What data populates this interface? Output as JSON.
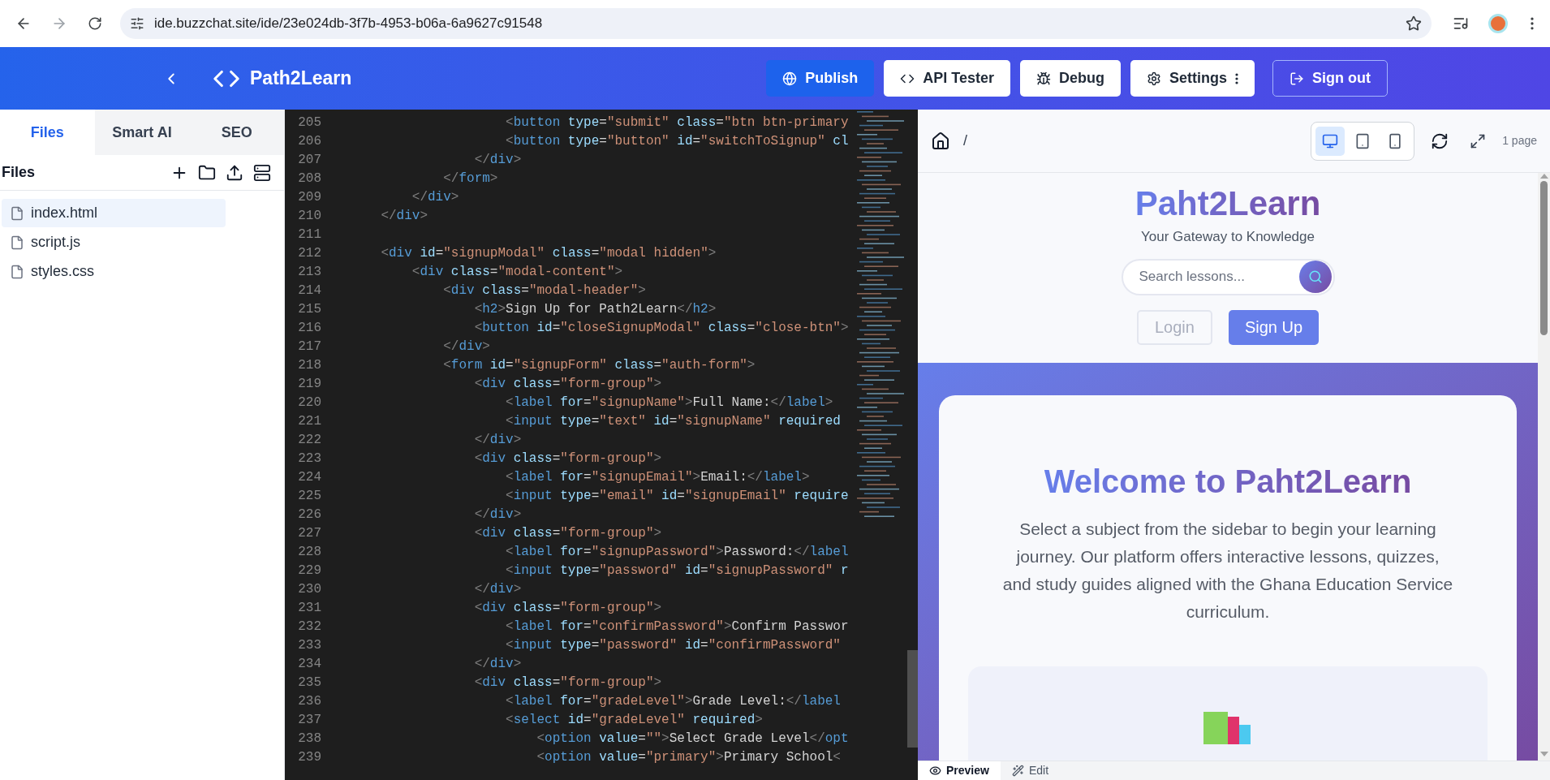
{
  "browser": {
    "url": "ide.buzzchat.site/ide/23e024db-3f7b-4953-b06a-6a9627c91548"
  },
  "header": {
    "title": "Path2Learn",
    "buttons": [
      {
        "label": "Publish",
        "kind": "publish"
      },
      {
        "label": "API Tester",
        "kind": "api"
      },
      {
        "label": "Debug",
        "kind": "debug"
      },
      {
        "label": "Settings",
        "kind": "settings"
      },
      {
        "label": "Sign out",
        "kind": "signout"
      }
    ]
  },
  "sidebar": {
    "tabs": [
      {
        "label": "Files",
        "selected": true
      },
      {
        "label": "Smart AI",
        "selected": false
      },
      {
        "label": "SEO",
        "selected": false
      }
    ],
    "heading": "Files",
    "files": [
      {
        "name": "index.html",
        "selected": true
      },
      {
        "name": "script.js",
        "selected": false
      },
      {
        "name": "styles.css",
        "selected": false
      }
    ]
  },
  "editor": {
    "lines": [
      {
        "number": "205",
        "code": "                    <button type=\"submit\" class=\"btn btn-primary"
      },
      {
        "number": "206",
        "code": "                    <button type=\"button\" id=\"switchToSignup\" cl"
      },
      {
        "number": "207",
        "code": "                </div>"
      },
      {
        "number": "208",
        "code": "            </form>"
      },
      {
        "number": "209",
        "code": "        </div>"
      },
      {
        "number": "210",
        "code": "    </div>"
      },
      {
        "number": "211"
      },
      {
        "number": "212",
        "code": "    <div id=\"signupModal\" class=\"modal hidden\">"
      },
      {
        "number": "213",
        "code": "        <div class=\"modal-content\">"
      },
      {
        "number": "214",
        "code": "            <div class=\"modal-header\">"
      },
      {
        "number": "215",
        "code": "                <h2>Sign Up for Path2Learn</h2>"
      },
      {
        "number": "216",
        "code": "                <button id=\"closeSignupModal\" class=\"close-btn\">"
      },
      {
        "number": "217",
        "code": "            </div>"
      },
      {
        "number": "218",
        "code": "            <form id=\"signupForm\" class=\"auth-form\">"
      },
      {
        "number": "219",
        "code": "                <div class=\"form-group\">"
      },
      {
        "number": "220",
        "code": "                    <label for=\"signupName\">Full Name:</label>"
      },
      {
        "number": "221",
        "code": "                    <input type=\"text\" id=\"signupName\" required"
      },
      {
        "number": "222",
        "code": "                </div>"
      },
      {
        "number": "223",
        "code": "                <div class=\"form-group\">"
      },
      {
        "number": "224",
        "code": "                    <label for=\"signupEmail\">Email:</label>"
      },
      {
        "number": "225",
        "code": "                    <input type=\"email\" id=\"signupEmail\" require"
      },
      {
        "number": "226",
        "code": "                </div>"
      },
      {
        "number": "227",
        "code": "                <div class=\"form-group\">"
      },
      {
        "number": "228",
        "code": "                    <label for=\"signupPassword\">Password:</label"
      },
      {
        "number": "229",
        "code": "                    <input type=\"password\" id=\"signupPassword\" r"
      },
      {
        "number": "230",
        "code": "                </div>"
      },
      {
        "number": "231",
        "code": "                <div class=\"form-group\">"
      },
      {
        "number": "232",
        "code": "                    <label for=\"confirmPassword\">Confirm Passwor"
      },
      {
        "number": "233",
        "code": "                    <input type=\"password\" id=\"confirmPassword\""
      },
      {
        "number": "234",
        "code": "                </div>"
      },
      {
        "number": "235",
        "code": "                <div class=\"form-group\">"
      },
      {
        "number": "236",
        "code": "                    <label for=\"gradeLevel\">Grade Level:</label"
      },
      {
        "number": "237",
        "code": "                    <select id=\"gradeLevel\" required>"
      },
      {
        "number": "238",
        "code": "                        <option value=\"\">Select Grade Level</opt"
      },
      {
        "number": "239",
        "code": "                        <option value=\"primary\">Primary School<"
      }
    ]
  },
  "preview": {
    "path": "/",
    "devices": [
      {
        "kind": "desktop",
        "selected": true
      },
      {
        "kind": "tablet",
        "selected": false
      },
      {
        "kind": "phone",
        "selected": false
      }
    ],
    "page_count": "1 page",
    "site": {
      "title": "Paht2Learn",
      "tagline": "Your Gateway to Knowledge",
      "search": {
        "placeholder": "Search lessons..."
      },
      "buttons": [
        {
          "label": "Login",
          "kind": "ghost"
        },
        {
          "label": "Sign Up",
          "kind": "primary"
        }
      ],
      "welcome": "Welcome to Paht2Learn",
      "intro": "Select a subject from the sidebar to begin your learning journey. Our platform offers interactive lessons, quizzes, and study guides aligned with the Ghana Education Service curriculum."
    },
    "tabs": [
      {
        "label": "Preview",
        "kind": "preview",
        "selected": true
      },
      {
        "label": "Edit",
        "kind": "edit",
        "selected": false
      }
    ]
  }
}
